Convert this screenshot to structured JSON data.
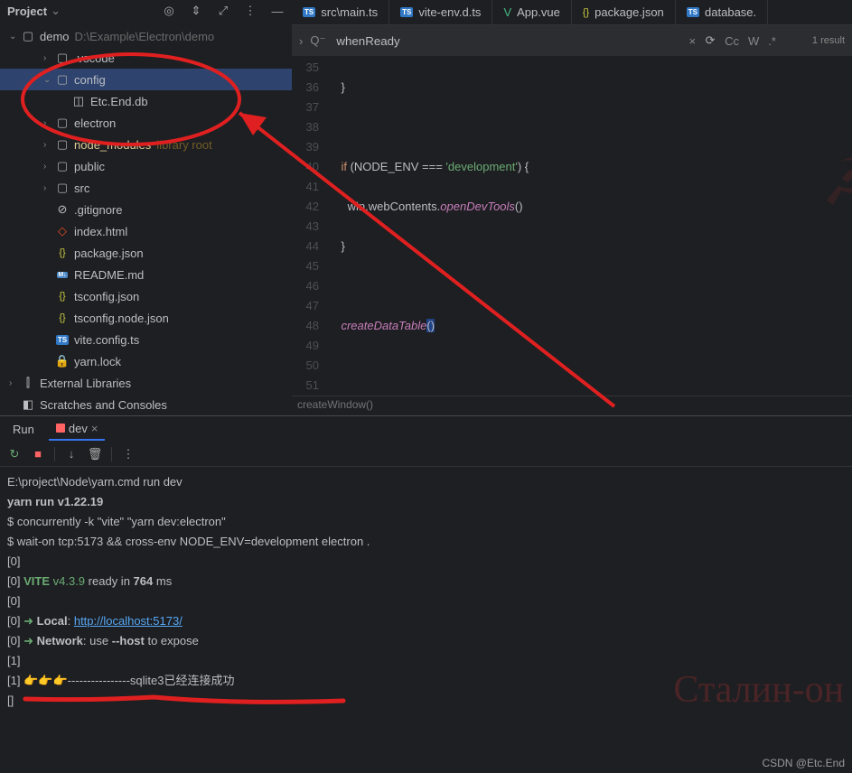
{
  "sidebar": {
    "title": "Project",
    "root": {
      "name": "demo",
      "path": "D:\\Example\\Electron\\demo"
    },
    "items": [
      {
        "name": ".vscode",
        "type": "folder",
        "arrow": ">",
        "indent": 2
      },
      {
        "name": "config",
        "type": "folder",
        "arrow": "v",
        "indent": 2,
        "selected": true
      },
      {
        "name": "Etc.End.db",
        "type": "db",
        "arrow": "",
        "indent": 3
      },
      {
        "name": "electron",
        "type": "folder",
        "arrow": ">",
        "indent": 2
      },
      {
        "name": "node_modules",
        "type": "folder",
        "arrow": ">",
        "indent": 2,
        "highlighted": true,
        "suffix": "library root"
      },
      {
        "name": "public",
        "type": "folder",
        "arrow": ">",
        "indent": 2
      },
      {
        "name": "src",
        "type": "folder",
        "arrow": ">",
        "indent": 2
      },
      {
        "name": ".gitignore",
        "type": "gitignore",
        "arrow": "",
        "indent": 2
      },
      {
        "name": "index.html",
        "type": "html",
        "arrow": "",
        "indent": 2
      },
      {
        "name": "package.json",
        "type": "json",
        "arrow": "",
        "indent": 2
      },
      {
        "name": "README.md",
        "type": "md",
        "arrow": "",
        "indent": 2
      },
      {
        "name": "tsconfig.json",
        "type": "json",
        "arrow": "",
        "indent": 2
      },
      {
        "name": "tsconfig.node.json",
        "type": "json",
        "arrow": "",
        "indent": 2
      },
      {
        "name": "vite.config.ts",
        "type": "ts",
        "arrow": "",
        "indent": 2
      },
      {
        "name": "yarn.lock",
        "type": "lock",
        "arrow": "",
        "indent": 2
      }
    ],
    "external": "External Libraries",
    "scratches": "Scratches and Consoles"
  },
  "editor": {
    "tabs": [
      {
        "label": "src\\main.ts",
        "type": "ts"
      },
      {
        "label": "vite-env.d.ts",
        "type": "ts"
      },
      {
        "label": "App.vue",
        "type": "vue"
      },
      {
        "label": "package.json",
        "type": "json"
      },
      {
        "label": "database.",
        "type": "ts"
      }
    ],
    "search": {
      "query": "whenReady",
      "match_label": "1 result",
      "opt_cc": "Cc",
      "opt_w": "W",
      "opt_regex": ".*"
    },
    "lines": [
      35,
      36,
      37,
      38,
      39,
      40,
      41,
      42,
      43,
      44,
      45,
      46,
      47,
      48,
      49,
      50,
      51
    ],
    "breadcrumb": "createWindow()"
  },
  "bottom": {
    "tab_run": "Run",
    "tab_dev": "dev",
    "terminal_lines": {
      "l1": "E:\\project\\Node\\yarn.cmd run dev",
      "l2": "yarn run v1.22.19",
      "l3": "$ concurrently -k \"vite\" \"yarn dev:electron\"",
      "l4": "$ wait-on tcp:5173 && cross-env NODE_ENV=development electron .",
      "l5": "[0]",
      "l6a": "[0]",
      "l6b": "VITE",
      "l6c": "v4.3.9",
      "l6d": "ready in",
      "l6e": "764",
      "l6f": "ms",
      "l7": "[0]",
      "l8a": "[0]",
      "l8b": "➜",
      "l8c": "Local",
      "l8d": ":",
      "l8e": "http://localhost:5173/",
      "l9a": "[0]",
      "l9b": "➜",
      "l9c": "Network",
      "l9d": ": use",
      "l9e": "--host",
      "l9f": "to expose",
      "l10": "[1]",
      "l11a": "[1]",
      "l11b": "👉👉👉----------------sqlite3已经连接成功",
      "l12": "[]"
    }
  },
  "watermark": "CSDN @Etc.End",
  "bg_text": "Сталин-он ка"
}
